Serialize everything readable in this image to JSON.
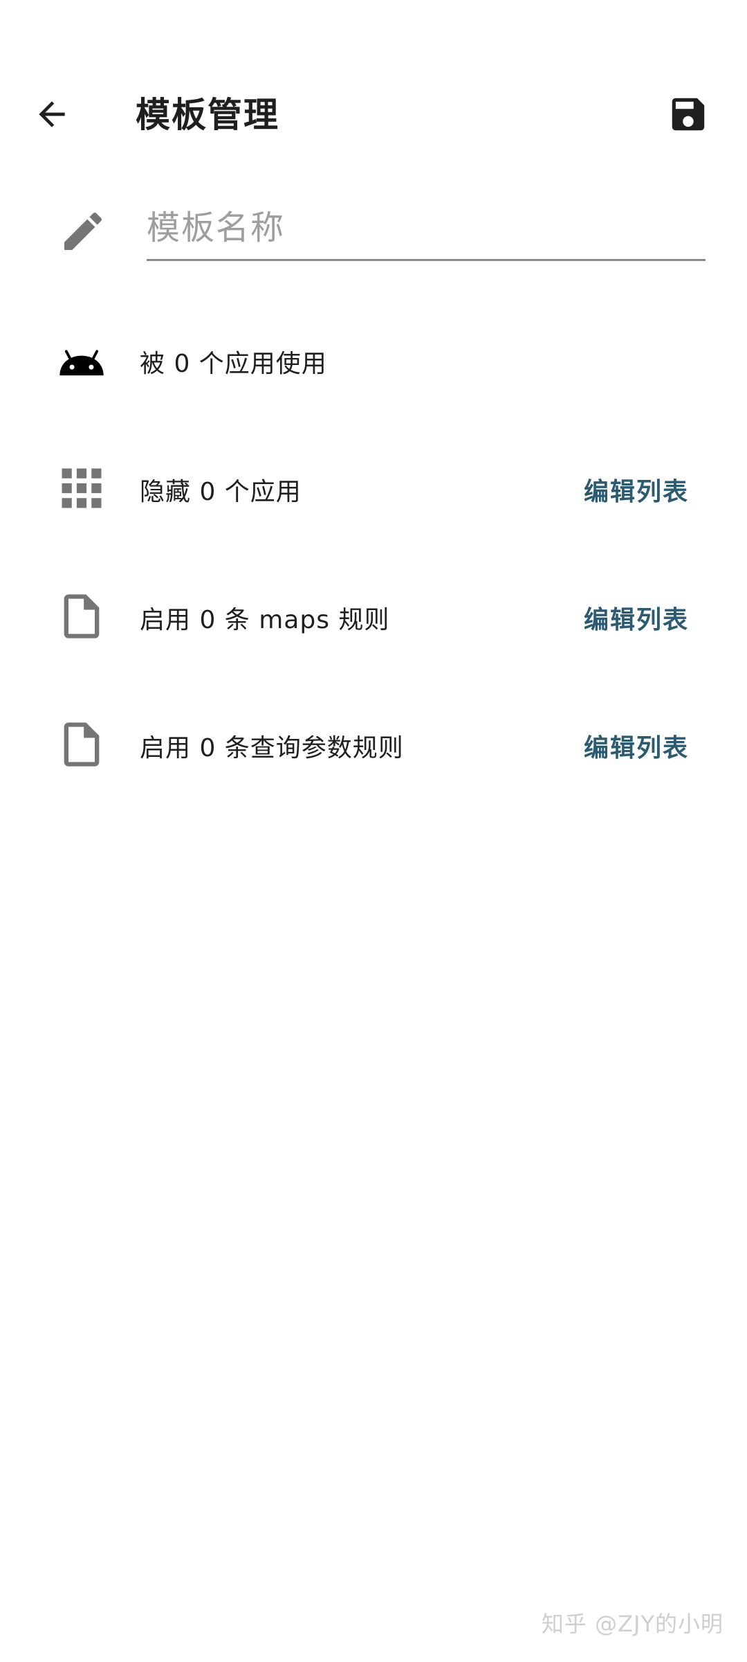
{
  "appbar": {
    "title": "模板管理",
    "back_icon": "arrow-left-icon",
    "save_icon": "floppy-disk-icon"
  },
  "name_field": {
    "icon": "pencil-icon",
    "placeholder": "模板名称",
    "value": ""
  },
  "rows": [
    {
      "icon": "android-icon",
      "label": "被 0 个应用使用",
      "action": ""
    },
    {
      "icon": "grid-icon",
      "label": "隐藏 0 个应用",
      "action": "编辑列表"
    },
    {
      "icon": "file-icon",
      "label": "启用 0 条 maps 规则",
      "action": "编辑列表"
    },
    {
      "icon": "file-icon",
      "label": "启用 0 条查询参数规则",
      "action": "编辑列表"
    }
  ],
  "watermark": "知乎 @ZJY的小明",
  "colors": {
    "accent": "#2b5a73",
    "icon_gray": "#757575",
    "text": "#1f1f1f",
    "underline": "#8a8a8a"
  }
}
